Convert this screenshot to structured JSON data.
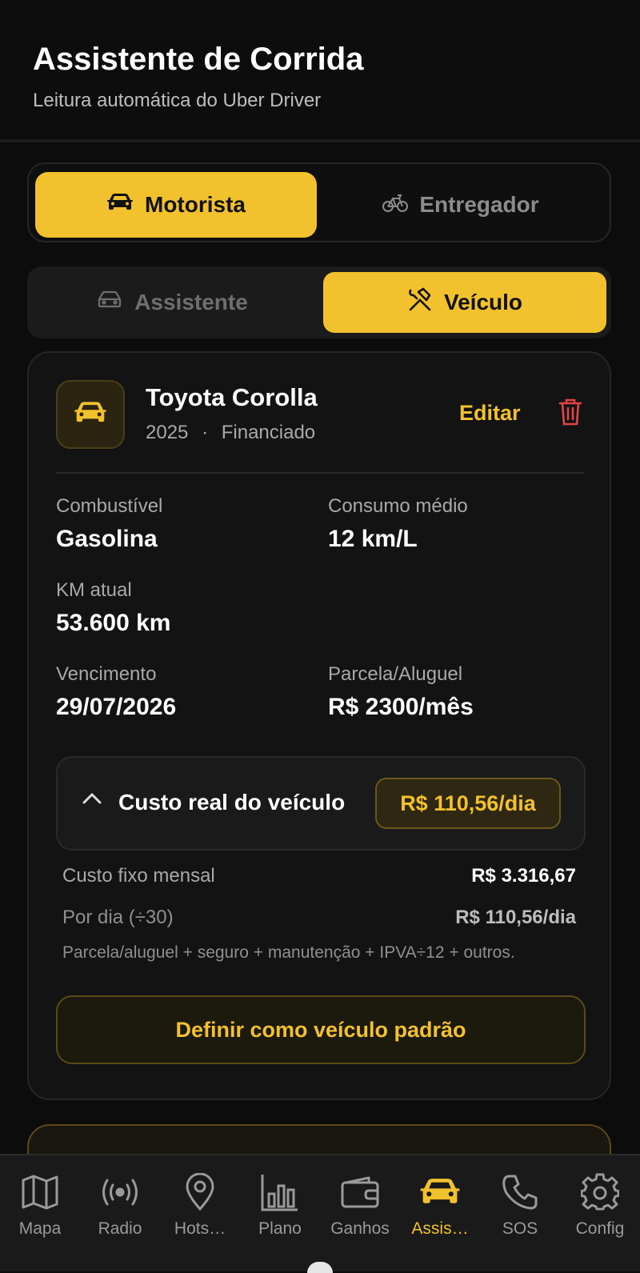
{
  "header": {
    "title": "Assistente de Corrida",
    "subtitle": "Leitura automática do Uber Driver"
  },
  "mode_switch": {
    "options": [
      {
        "label": "Motorista",
        "icon": "car-icon",
        "active": true
      },
      {
        "label": "Entregador",
        "icon": "bike-icon",
        "active": false
      }
    ]
  },
  "sub_tabs": {
    "options": [
      {
        "label": "Assistente",
        "icon": "car-outline-icon",
        "active": false
      },
      {
        "label": "Veículo",
        "icon": "tools-icon",
        "active": true
      }
    ]
  },
  "vehicle": {
    "name": "Toyota Corolla",
    "year": "2025",
    "separator": "·",
    "financing": "Financiado",
    "edit_label": "Editar",
    "fields": {
      "fuel_label": "Combustível",
      "fuel_value": "Gasolina",
      "consumption_label": "Consumo médio",
      "consumption_value": "12 km/L",
      "km_label": "KM atual",
      "km_value": "53.600 km",
      "due_label": "Vencimento",
      "due_value": "29/07/2026",
      "installment_label": "Parcela/Aluguel",
      "installment_value": "R$ 2300/mês"
    },
    "cost": {
      "title": "Custo real do veículo",
      "badge": "R$ 110,56/dia",
      "fixed_label": "Custo fixo mensal",
      "fixed_value": "R$ 3.316,67",
      "daily_label": "Por dia (÷30)",
      "daily_value": "R$ 110,56/dia",
      "note": "Parcela/aluguel + seguro + manutenção + IPVA÷12 + outros."
    },
    "default_button": "Definir como veículo padrão"
  },
  "colors": {
    "accent": "#f2c12e",
    "background": "#0c0c0c",
    "danger": "#e04545"
  },
  "nav": {
    "items": [
      {
        "label": "Mapa",
        "icon": "map-icon",
        "active": false
      },
      {
        "label": "Radio",
        "icon": "radio-icon",
        "active": false
      },
      {
        "label": "Hots…",
        "icon": "location-pin-icon",
        "active": false
      },
      {
        "label": "Plano",
        "icon": "bar-chart-icon",
        "active": false
      },
      {
        "label": "Ganhos",
        "icon": "wallet-icon",
        "active": false
      },
      {
        "label": "Assis…",
        "icon": "car-icon",
        "active": true
      },
      {
        "label": "SOS",
        "icon": "phone-icon",
        "active": false
      },
      {
        "label": "Config",
        "icon": "gear-icon",
        "active": false
      }
    ]
  }
}
